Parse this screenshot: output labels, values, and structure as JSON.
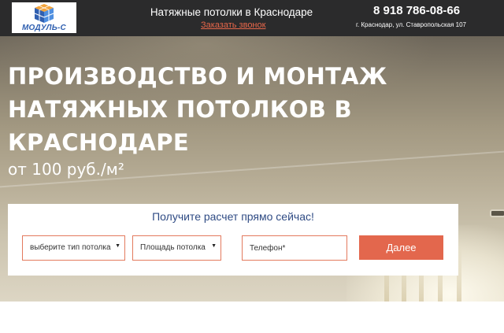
{
  "header": {
    "logo_text": "МОДУЛЬ-С",
    "site_title": "Натяжные потолки в Краснодаре",
    "callback_link": "Заказать звонок",
    "phone": "8 918 786-08-66",
    "address": "г. Краснодар, ул. Ставропольская 107"
  },
  "hero": {
    "headline": "ПРОИЗВОДСТВО И МОНТАЖ НАТЯЖНЫХ ПОТОЛКОВ В КРАСНОДАРЕ",
    "price": "от 100 руб./м²"
  },
  "form": {
    "title": "Получите расчет прямо сейчас!",
    "ceiling_type_select": "выберите тип потолка",
    "area_select": "Площадь потолка",
    "phone_placeholder": "Телефон*",
    "submit_label": "Далее"
  },
  "colors": {
    "header_bg": "#2b2b2c",
    "accent": "#e3674d",
    "form_title": "#2f4b84",
    "logo_blue": "#2f5fb0"
  },
  "icons": {
    "logo": "modul-s-cube-logo",
    "select_arrow": "triangle-down"
  }
}
